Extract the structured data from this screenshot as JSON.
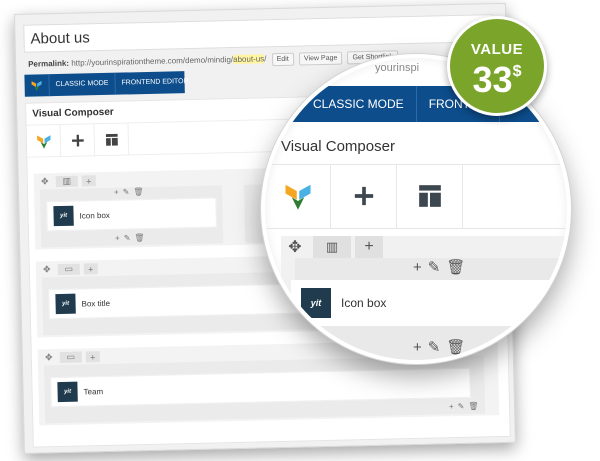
{
  "page": {
    "title_value": "About us",
    "permalink": {
      "label": "Permalink:",
      "base_url": "http://yourinspirationtheme.com/demo/mindig/",
      "slug": "about-us",
      "trailing": "/",
      "buttons": [
        "Edit",
        "View Page",
        "Get Shortlink"
      ]
    },
    "modes": [
      "CLASSIC MODE",
      "FRONTEND EDITOR"
    ]
  },
  "composer": {
    "title": "Visual Composer",
    "tools": [
      "visual-composer-logo-icon",
      "add-icon",
      "layout-icon"
    ],
    "rows": [
      {
        "element": "Icon box"
      },
      {
        "element": "Box title"
      },
      {
        "element": "Team"
      }
    ],
    "yit_label": "yit"
  },
  "lens": {
    "url_fragment": "yourinspi",
    "modes": [
      "CLASSIC MODE",
      "FRONTEN"
    ],
    "title": "Visual Composer",
    "element_label": "Icon box",
    "yit_label": "yit"
  },
  "badge": {
    "label": "VALUE",
    "amount": "33",
    "currency": "$",
    "color": "#7aa52a"
  },
  "colors": {
    "mode_bar": "#0d4d8c"
  }
}
